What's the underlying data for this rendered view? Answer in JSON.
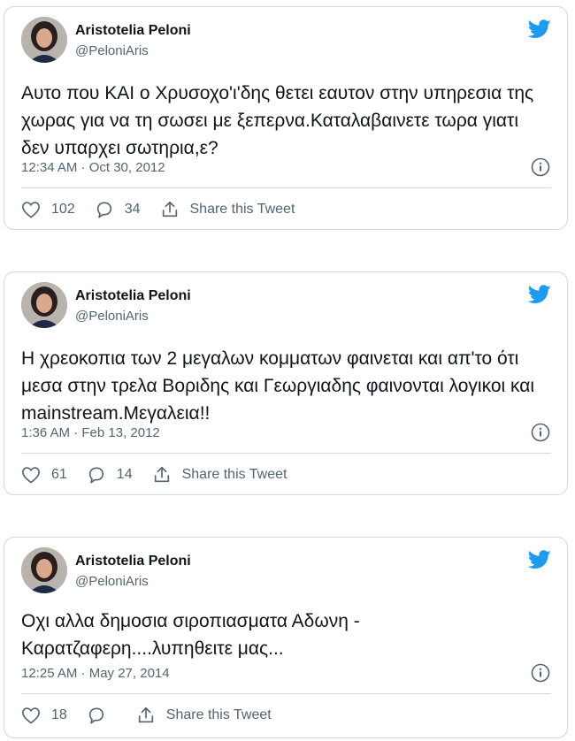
{
  "tweets": [
    {
      "name": "Aristotelia Peloni",
      "handle": "@PeloniAris",
      "text": "Αυτο που ΚΑΙ ο Χρυσοχο'ι'δης θετει εαυτον στην υπηρεσια της χωρας για να τη σωσει με ξεπερνα.Καταλαβαινετε τωρα γιατι δεν υπαρχει σωτηρια,ε?",
      "timestamp": "12:34 AM · Oct 30, 2012",
      "likes": "102",
      "replies": "34",
      "share_label": "Share this Tweet"
    },
    {
      "name": "Aristotelia Peloni",
      "handle": "@PeloniAris",
      "text": "Η χρεοκοπια των 2 μεγαλων κομματων φαινεται και απ'το ότι μεσα στην τρελα Βοριδης και Γεωργιαδης φαινονται λογικοι και mainstream.Μεγαλεια!!",
      "timestamp": "1:36 AM · Feb 13, 2012",
      "likes": "61",
      "replies": "14",
      "share_label": "Share this Tweet"
    },
    {
      "name": "Aristotelia Peloni",
      "handle": "@PeloniAris",
      "text": "Οχι αλλα δημοσια σιροπιασματα Αδωνη - Καρατζαφερη....λυπηθειτε μας...",
      "timestamp": "12:25 AM · May 27, 2014",
      "likes": "18",
      "replies": "",
      "share_label": "Share this Tweet"
    }
  ],
  "colors": {
    "twitter_blue": "#1d9bf0",
    "secondary_text": "#536471",
    "border": "#cfd9de"
  }
}
